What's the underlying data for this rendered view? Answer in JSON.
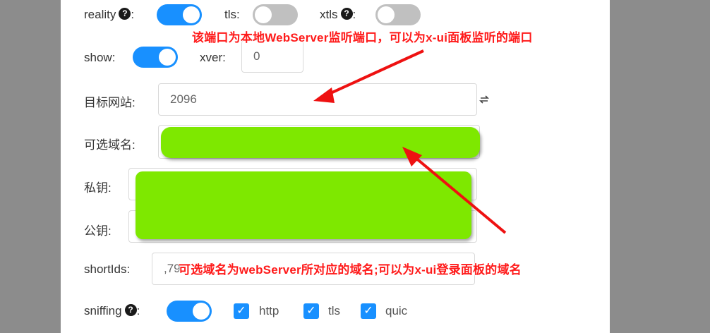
{
  "form": {
    "reality_label": "reality",
    "tls_label": "tls",
    "xtls_label": "xtls",
    "show_label": "show",
    "xver_label": "xver",
    "xver_value": "0",
    "colon": ":",
    "help_glyph": "?",
    "target_label": "目标网站:",
    "target_value": "2096",
    "server_names_label": "可选域名:",
    "private_key_label": "私钥:",
    "public_key_label": "公钥:",
    "short_ids_label": "shortIds:",
    "short_ids_value": ",79",
    "sniffing_label": "sniffing",
    "http_label": "http",
    "tls_sniff_label": "tls",
    "quic_label": "quic",
    "reality_on": true,
    "tls_on": false,
    "xtls_on": false,
    "show_on": true,
    "sniffing_on": true
  },
  "annotations": {
    "top": "该端口为本地WebServer监听端口，可以为x-ui面板监听的端口",
    "bottom": "可选域名为webServer所对应的域名;可以为x-ui登录面板的域名"
  },
  "colors": {
    "toggle_on": "#1890ff",
    "toggle_off": "#c0c0c0",
    "redaction": "#7ee800",
    "annotation": "#ff1a1a"
  },
  "icons": {
    "help": "question-circle-icon",
    "swap": "swap-icon",
    "check": "check-icon",
    "arrow": "red-arrow"
  }
}
